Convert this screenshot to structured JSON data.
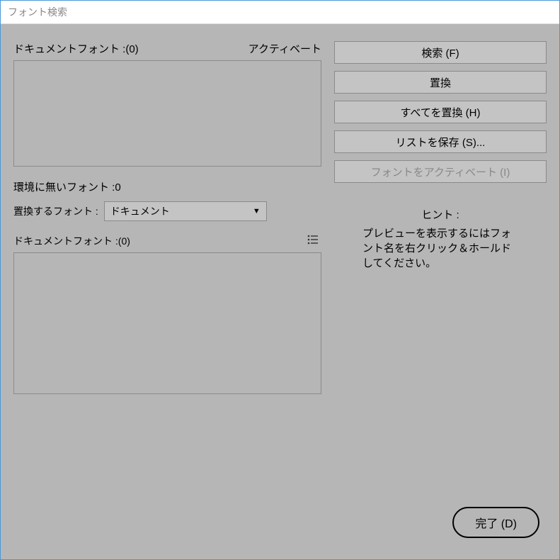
{
  "window": {
    "title": "フォント検索"
  },
  "left": {
    "docFontsLabel": "ドキュメントフォント :(0)",
    "activateHeader": "アクティベート",
    "missingLabel": "環境に無いフォント :0",
    "replaceWithLabel": "置換するフォント :",
    "selectValue": "ドキュメント",
    "docFontsLabel2": "ドキュメントフォント :(0)"
  },
  "buttons": {
    "search": "検索 (F)",
    "replace": "置換",
    "replaceAll": "すべてを置換 (H)",
    "saveList": "リストを保存 (S)...",
    "activateFont": "フォントをアクティベート (I)",
    "done": "完了 (D)"
  },
  "hint": {
    "title": "ヒント :",
    "text": "プレビューを表示するにはフォント名を右クリック＆ホールドしてください。"
  }
}
